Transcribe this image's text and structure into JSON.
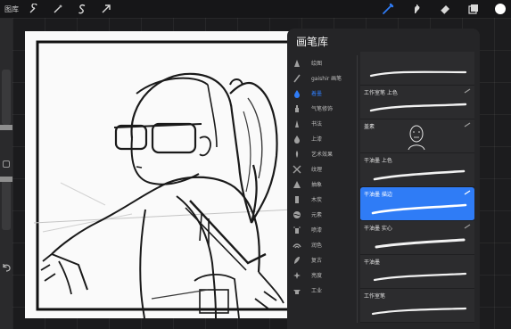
{
  "toolbar": {
    "gallery_label": "图库",
    "left_tools": [
      "wrench-icon",
      "magic-wand-icon",
      "selection-s-icon",
      "transform-arrow-icon"
    ],
    "right_tools": [
      "brush-icon",
      "smudge-icon",
      "eraser-icon",
      "layers-icon",
      "color-icon"
    ],
    "accent_color": "#2f7cf6"
  },
  "panel": {
    "title": "画笔库",
    "categories": [
      {
        "label": "绘图",
        "icon": "pencil-tip-icon"
      },
      {
        "label": "gaishir 画笔",
        "icon": "brush-set-icon"
      },
      {
        "label": "着墨",
        "icon": "ink-drop-icon",
        "active": true
      },
      {
        "label": "气笔修饰",
        "icon": "airbrush-icon"
      },
      {
        "label": "书法",
        "icon": "calligraphy-icon"
      },
      {
        "label": "上漆",
        "icon": "paint-drop-icon"
      },
      {
        "label": "艺术效果",
        "icon": "art-brush-icon"
      },
      {
        "label": "纹理",
        "icon": "texture-icon"
      },
      {
        "label": "抽象",
        "icon": "abstract-icon"
      },
      {
        "label": "木炭",
        "icon": "charcoal-icon"
      },
      {
        "label": "元素",
        "icon": "element-icon"
      },
      {
        "label": "喷漆",
        "icon": "spray-icon"
      },
      {
        "label": "润色",
        "icon": "touchup-icon"
      },
      {
        "label": "复古",
        "icon": "retro-icon"
      },
      {
        "label": "亮度",
        "icon": "luminance-icon"
      },
      {
        "label": "工业",
        "icon": "industry-icon"
      }
    ],
    "brushes": [
      {
        "name": ""
      },
      {
        "name": "工作室笔 上色"
      },
      {
        "name": "盖素"
      },
      {
        "name": "干油墨 上色"
      },
      {
        "name": "干油墨 描边",
        "selected": true
      },
      {
        "name": "干油墨 实心"
      },
      {
        "name": "干油墨"
      },
      {
        "name": "工作室笔"
      }
    ]
  }
}
